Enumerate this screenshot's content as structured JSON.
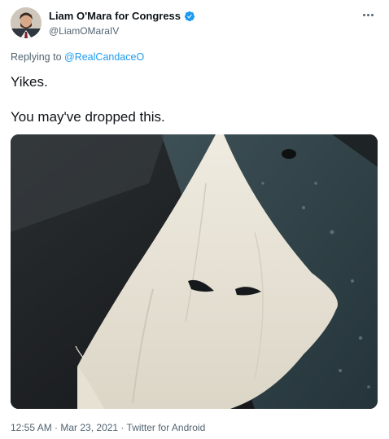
{
  "author": {
    "name": "Liam O'Mara for Congress",
    "handle": "@LiamOMaraIV",
    "verified": true
  },
  "reply": {
    "prefix": "Replying to ",
    "mention": "@RealCandaceO"
  },
  "tweet": {
    "line1": "Yikes.",
    "line2": "You may've dropped this."
  },
  "meta": {
    "time": "12:55 AM",
    "sep1": " · ",
    "date": "Mar 23, 2021",
    "sep2": " · ",
    "source": "Twitter for Android"
  },
  "icons": {
    "verified": "verified-badge-icon",
    "more": "more-horizontal-icon"
  },
  "colors": {
    "accent": "#1d9bf0",
    "secondary": "#536471"
  }
}
